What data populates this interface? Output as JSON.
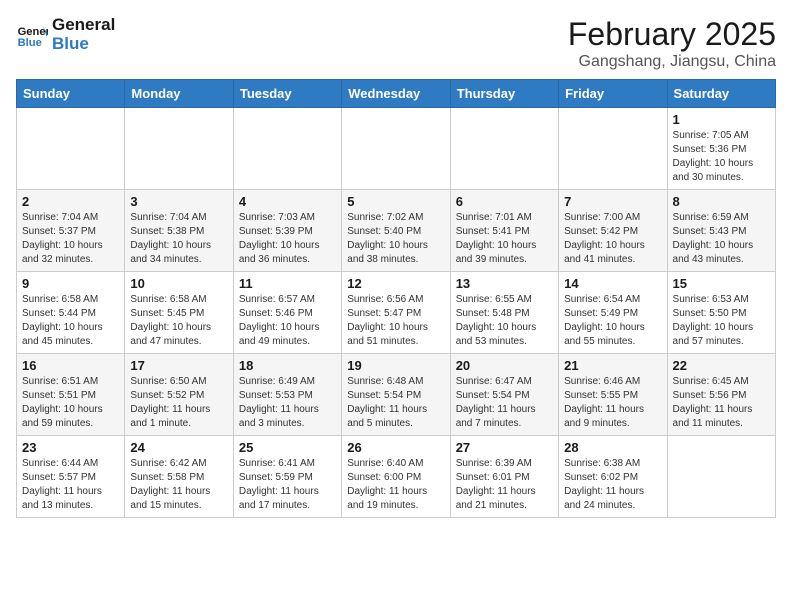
{
  "header": {
    "logo_line1": "General",
    "logo_line2": "Blue",
    "month_year": "February 2025",
    "location": "Gangshang, Jiangsu, China"
  },
  "days_of_week": [
    "Sunday",
    "Monday",
    "Tuesday",
    "Wednesday",
    "Thursday",
    "Friday",
    "Saturday"
  ],
  "weeks": [
    [
      {
        "day": "",
        "info": ""
      },
      {
        "day": "",
        "info": ""
      },
      {
        "day": "",
        "info": ""
      },
      {
        "day": "",
        "info": ""
      },
      {
        "day": "",
        "info": ""
      },
      {
        "day": "",
        "info": ""
      },
      {
        "day": "1",
        "info": "Sunrise: 7:05 AM\nSunset: 5:36 PM\nDaylight: 10 hours and 30 minutes."
      }
    ],
    [
      {
        "day": "2",
        "info": "Sunrise: 7:04 AM\nSunset: 5:37 PM\nDaylight: 10 hours and 32 minutes."
      },
      {
        "day": "3",
        "info": "Sunrise: 7:04 AM\nSunset: 5:38 PM\nDaylight: 10 hours and 34 minutes."
      },
      {
        "day": "4",
        "info": "Sunrise: 7:03 AM\nSunset: 5:39 PM\nDaylight: 10 hours and 36 minutes."
      },
      {
        "day": "5",
        "info": "Sunrise: 7:02 AM\nSunset: 5:40 PM\nDaylight: 10 hours and 38 minutes."
      },
      {
        "day": "6",
        "info": "Sunrise: 7:01 AM\nSunset: 5:41 PM\nDaylight: 10 hours and 39 minutes."
      },
      {
        "day": "7",
        "info": "Sunrise: 7:00 AM\nSunset: 5:42 PM\nDaylight: 10 hours and 41 minutes."
      },
      {
        "day": "8",
        "info": "Sunrise: 6:59 AM\nSunset: 5:43 PM\nDaylight: 10 hours and 43 minutes."
      }
    ],
    [
      {
        "day": "9",
        "info": "Sunrise: 6:58 AM\nSunset: 5:44 PM\nDaylight: 10 hours and 45 minutes."
      },
      {
        "day": "10",
        "info": "Sunrise: 6:58 AM\nSunset: 5:45 PM\nDaylight: 10 hours and 47 minutes."
      },
      {
        "day": "11",
        "info": "Sunrise: 6:57 AM\nSunset: 5:46 PM\nDaylight: 10 hours and 49 minutes."
      },
      {
        "day": "12",
        "info": "Sunrise: 6:56 AM\nSunset: 5:47 PM\nDaylight: 10 hours and 51 minutes."
      },
      {
        "day": "13",
        "info": "Sunrise: 6:55 AM\nSunset: 5:48 PM\nDaylight: 10 hours and 53 minutes."
      },
      {
        "day": "14",
        "info": "Sunrise: 6:54 AM\nSunset: 5:49 PM\nDaylight: 10 hours and 55 minutes."
      },
      {
        "day": "15",
        "info": "Sunrise: 6:53 AM\nSunset: 5:50 PM\nDaylight: 10 hours and 57 minutes."
      }
    ],
    [
      {
        "day": "16",
        "info": "Sunrise: 6:51 AM\nSunset: 5:51 PM\nDaylight: 10 hours and 59 minutes."
      },
      {
        "day": "17",
        "info": "Sunrise: 6:50 AM\nSunset: 5:52 PM\nDaylight: 11 hours and 1 minute."
      },
      {
        "day": "18",
        "info": "Sunrise: 6:49 AM\nSunset: 5:53 PM\nDaylight: 11 hours and 3 minutes."
      },
      {
        "day": "19",
        "info": "Sunrise: 6:48 AM\nSunset: 5:54 PM\nDaylight: 11 hours and 5 minutes."
      },
      {
        "day": "20",
        "info": "Sunrise: 6:47 AM\nSunset: 5:54 PM\nDaylight: 11 hours and 7 minutes."
      },
      {
        "day": "21",
        "info": "Sunrise: 6:46 AM\nSunset: 5:55 PM\nDaylight: 11 hours and 9 minutes."
      },
      {
        "day": "22",
        "info": "Sunrise: 6:45 AM\nSunset: 5:56 PM\nDaylight: 11 hours and 11 minutes."
      }
    ],
    [
      {
        "day": "23",
        "info": "Sunrise: 6:44 AM\nSunset: 5:57 PM\nDaylight: 11 hours and 13 minutes."
      },
      {
        "day": "24",
        "info": "Sunrise: 6:42 AM\nSunset: 5:58 PM\nDaylight: 11 hours and 15 minutes."
      },
      {
        "day": "25",
        "info": "Sunrise: 6:41 AM\nSunset: 5:59 PM\nDaylight: 11 hours and 17 minutes."
      },
      {
        "day": "26",
        "info": "Sunrise: 6:40 AM\nSunset: 6:00 PM\nDaylight: 11 hours and 19 minutes."
      },
      {
        "day": "27",
        "info": "Sunrise: 6:39 AM\nSunset: 6:01 PM\nDaylight: 11 hours and 21 minutes."
      },
      {
        "day": "28",
        "info": "Sunrise: 6:38 AM\nSunset: 6:02 PM\nDaylight: 11 hours and 24 minutes."
      },
      {
        "day": "",
        "info": ""
      }
    ]
  ]
}
